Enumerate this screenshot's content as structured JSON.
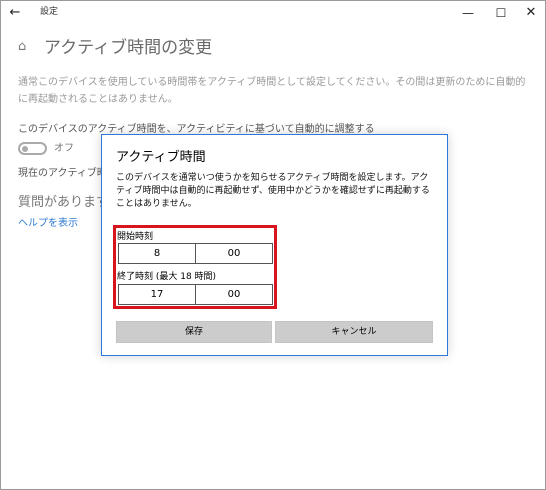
{
  "titlebar": {
    "back_glyph": "←",
    "title": "設定",
    "minimize_glyph": "—",
    "maximize_glyph": "☐",
    "close_glyph": "✕"
  },
  "page": {
    "home_glyph": "⌂",
    "title": "アクティブ時間の変更",
    "description": "通常このデバイスを使用している時間帯をアクティブ時間として設定してください。その間は更新のために自動的に再起動されることはありません。",
    "auto_adjust_label": "このデバイスのアクティブ時間を、アクティビティに基づいて自動的に調整する",
    "toggle_state": "オフ",
    "current_label": "現在のアクティブ時間",
    "question_heading": "質問がありますか",
    "help_link": "ヘルプを表示"
  },
  "dialog": {
    "title": "アクティブ時間",
    "text": "このデバイスを通常いつ使うかを知らせるアクティブ時間を設定します。アクティブ時間中は自動的に再起動せず、使用中かどうかを確認せずに再起動することはありません。",
    "start_label": "開始時刻",
    "start_hour": "8",
    "start_minute": "00",
    "end_label": "終了時刻 (最大 18 時間)",
    "end_hour": "17",
    "end_minute": "00",
    "save_label": "保存",
    "cancel_label": "キャンセル"
  },
  "colors": {
    "dialog_border": "#2b79d8",
    "highlight": "#d8141e",
    "link": "#2e7bd1"
  }
}
